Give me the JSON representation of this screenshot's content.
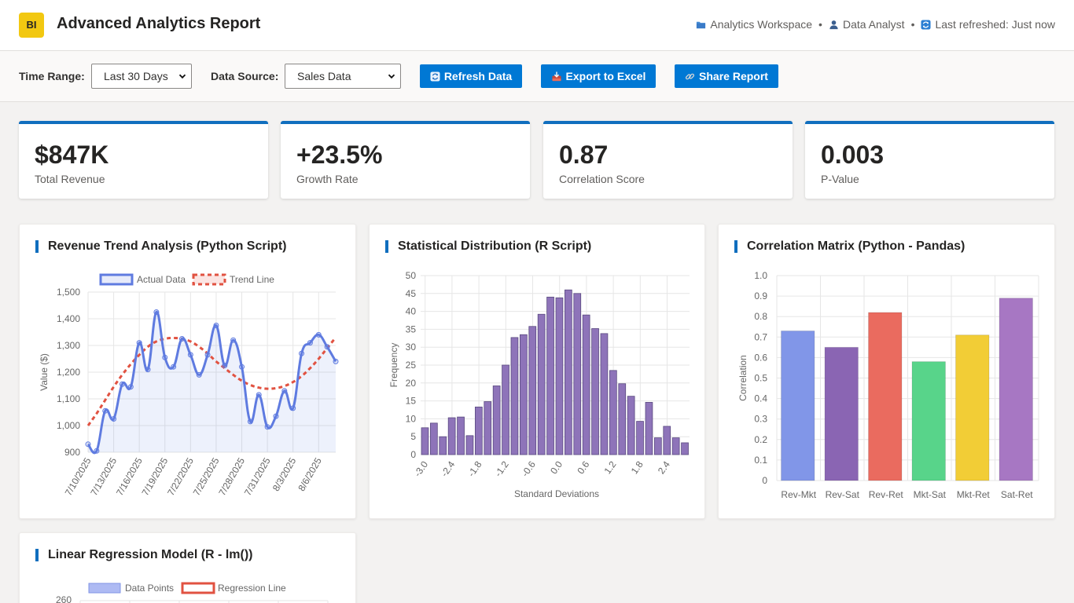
{
  "header": {
    "logo": "BI",
    "title": "Advanced Analytics Report",
    "workspace": "Analytics Workspace",
    "user": "Data Analyst",
    "refresh_status": "Last refreshed: Just now"
  },
  "toolbar": {
    "time_range_label": "Time Range:",
    "time_range_value": "Last 30 Days",
    "data_source_label": "Data Source:",
    "data_source_value": "Sales Data",
    "refresh_label": "Refresh Data",
    "export_label": "Export to Excel",
    "share_label": "Share Report"
  },
  "kpis": [
    {
      "value": "$847K",
      "label": "Total Revenue"
    },
    {
      "value": "+23.5%",
      "label": "Growth Rate"
    },
    {
      "value": "0.87",
      "label": "Correlation Score"
    },
    {
      "value": "0.003",
      "label": "P-Value"
    }
  ],
  "colors": {
    "accent": "#0078d4",
    "kpi_border": "#106ebe",
    "line": "#5f7be0",
    "trend": "#e15241",
    "histogram": "#8e74b9"
  },
  "chart_data": [
    {
      "type": "line",
      "title": "Revenue Trend Analysis (Python Script)",
      "ylabel": "Value ($)",
      "xlabel": "",
      "ylim": [
        900,
        1500
      ],
      "yticks": [
        900,
        1000,
        1100,
        1200,
        1300,
        1400,
        1500
      ],
      "x_tick_labels": [
        "7/10/2025",
        "7/13/2025",
        "7/16/2025",
        "7/19/2025",
        "7/22/2025",
        "7/25/2025",
        "7/28/2025",
        "7/31/2025",
        "8/3/2025",
        "8/6/2025"
      ],
      "legend": [
        "Actual Data",
        "Trend Line"
      ],
      "legend_position": "top",
      "series": [
        {
          "name": "Actual Data",
          "x": [
            "7/10/2025",
            "7/11/2025",
            "7/12/2025",
            "7/13/2025",
            "7/14/2025",
            "7/15/2025",
            "7/16/2025",
            "7/17/2025",
            "7/18/2025",
            "7/19/2025",
            "7/20/2025",
            "7/21/2025",
            "7/22/2025",
            "7/23/2025",
            "7/24/2025",
            "7/25/2025",
            "7/26/2025",
            "7/27/2025",
            "7/28/2025",
            "7/29/2025",
            "7/30/2025",
            "7/31/2025",
            "8/1/2025",
            "8/2/2025",
            "8/3/2025",
            "8/4/2025",
            "8/5/2025",
            "8/6/2025",
            "8/7/2025",
            "8/8/2025"
          ],
          "values": [
            930,
            905,
            1055,
            1025,
            1155,
            1145,
            1310,
            1210,
            1425,
            1255,
            1220,
            1325,
            1265,
            1190,
            1265,
            1375,
            1225,
            1320,
            1220,
            1015,
            1115,
            995,
            1035,
            1130,
            1065,
            1270,
            1310,
            1340,
            1295,
            1240
          ]
        },
        {
          "name": "Trend Line",
          "x": [
            "7/10/2025",
            "7/11/2025",
            "7/12/2025",
            "7/13/2025",
            "7/14/2025",
            "7/15/2025",
            "7/16/2025",
            "7/17/2025",
            "7/18/2025",
            "7/19/2025",
            "7/20/2025",
            "7/21/2025",
            "7/22/2025",
            "7/23/2025",
            "7/24/2025",
            "7/25/2025",
            "7/26/2025",
            "7/27/2025",
            "7/28/2025",
            "7/29/2025",
            "7/30/2025",
            "7/31/2025",
            "8/1/2025",
            "8/2/2025",
            "8/3/2025",
            "8/4/2025",
            "8/5/2025",
            "8/6/2025",
            "8/7/2025",
            "8/8/2025"
          ],
          "values": [
            1000,
            1045,
            1095,
            1145,
            1190,
            1230,
            1265,
            1295,
            1315,
            1325,
            1328,
            1325,
            1315,
            1295,
            1270,
            1240,
            1215,
            1190,
            1168,
            1152,
            1142,
            1138,
            1140,
            1148,
            1163,
            1185,
            1215,
            1250,
            1290,
            1330
          ]
        }
      ]
    },
    {
      "type": "bar",
      "title": "Statistical Distribution (R Script)",
      "xlabel": "Standard Deviations",
      "ylabel": "Frequency",
      "ylim": [
        0,
        50
      ],
      "yticks": [
        0,
        5,
        10,
        15,
        20,
        25,
        30,
        35,
        40,
        45,
        50
      ],
      "x_tick_labels": [
        "-3.0",
        "-2.4",
        "-1.8",
        "-1.2",
        "-0.6",
        "0.0",
        "0.6",
        "1.2",
        "1.8",
        "2.4"
      ],
      "categories": [
        "-3.0",
        "-2.8",
        "-2.6",
        "-2.4",
        "-2.2",
        "-2.0",
        "-1.8",
        "-1.6",
        "-1.4",
        "-1.2",
        "-1.0",
        "-0.8",
        "-0.6",
        "-0.4",
        "-0.2",
        "0.0",
        "0.2",
        "0.4",
        "0.6",
        "0.8",
        "1.0",
        "1.2",
        "1.4",
        "1.6",
        "1.8",
        "2.0",
        "2.2",
        "2.4",
        "2.6",
        "2.8"
      ],
      "values": [
        7.5,
        8.8,
        5.0,
        10.3,
        10.5,
        5.3,
        13.3,
        14.8,
        19.2,
        25.0,
        32.7,
        33.5,
        35.8,
        39.2,
        44.0,
        43.8,
        46.0,
        45.0,
        39.0,
        35.2,
        33.8,
        23.5,
        19.8,
        16.3,
        9.3,
        14.6,
        4.7,
        7.9,
        4.7,
        3.3
      ]
    },
    {
      "type": "bar",
      "title": "Correlation Matrix (Python - Pandas)",
      "xlabel": "",
      "ylabel": "Correlation",
      "ylim": [
        0,
        1.0
      ],
      "yticks": [
        "0",
        "0.1",
        "0.2",
        "0.3",
        "0.4",
        "0.5",
        "0.6",
        "0.7",
        "0.8",
        "0.9",
        "1.0"
      ],
      "categories": [
        "Rev-Mkt",
        "Rev-Sat",
        "Rev-Ret",
        "Mkt-Sat",
        "Mkt-Ret",
        "Sat-Ret"
      ],
      "values": [
        0.73,
        0.65,
        0.82,
        0.58,
        0.71,
        0.89
      ],
      "bar_colors": [
        "#8196e8",
        "#8a65b3",
        "#ea6b5f",
        "#58d48a",
        "#f2cd36",
        "#a777c3"
      ]
    },
    {
      "type": "scatter",
      "title": "Linear Regression Model (R - lm())",
      "legend": [
        "Data Points",
        "Regression Line"
      ],
      "legend_position": "top",
      "yticks": [
        260
      ]
    }
  ]
}
